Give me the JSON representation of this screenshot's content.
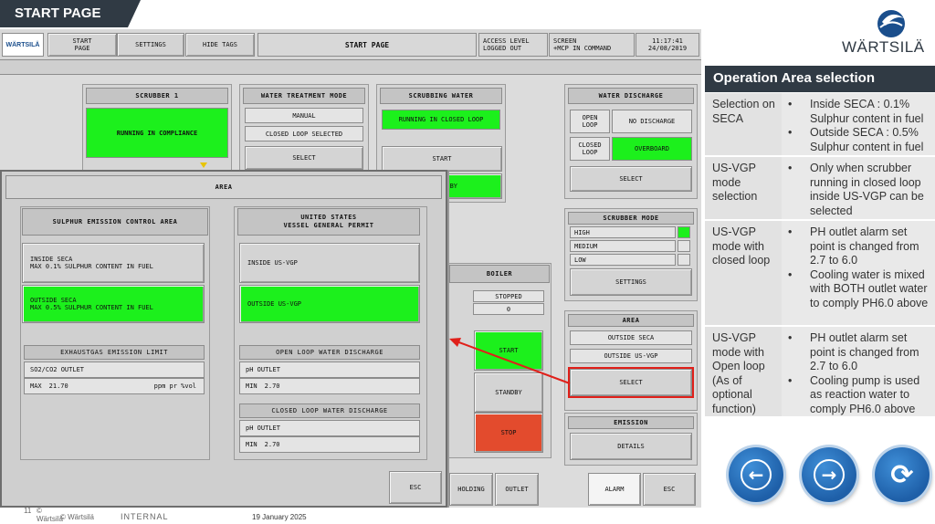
{
  "slide": {
    "title": "START PAGE"
  },
  "topbar": {
    "logo_text": "WÄRTSILÄ",
    "start_page_btn": "START\nPAGE",
    "settings_btn": "SETTINGS",
    "hide_tags_btn": "HIDE TAGS",
    "screen_title": "START PAGE",
    "access_level_label": "ACCESS LEVEL",
    "access_level_value": "LOGGED OUT",
    "screen_label": "SCREEN",
    "screen_value": "+MCP IN COMMAND",
    "time": "11:17:41",
    "date": "24/08/2019"
  },
  "scrubber": {
    "header": "SCRUBBER 1",
    "status": "RUNNING IN COMPLIANCE"
  },
  "water_treatment": {
    "header": "WATER TREATMENT MODE",
    "mode": "MANUAL",
    "loop": "CLOSED LOOP SELECTED",
    "select_btn": "SELECT"
  },
  "scrubbing_water": {
    "header": "SCRUBBING WATER",
    "status": "RUNNING IN CLOSED LOOP",
    "start_btn": "START",
    "standby_btn": "BY"
  },
  "water_discharge": {
    "header": "WATER DISCHARGE",
    "open_loop_label": "OPEN\nLOOP",
    "open_loop_value": "NO DISCHARGE",
    "closed_loop_label": "CLOSED\nLOOP",
    "closed_loop_value": "OVERBOARD",
    "select_btn": "SELECT"
  },
  "scrubber_mode": {
    "header": "SCRUBBER MODE",
    "high": "HIGH",
    "medium": "MEDIUM",
    "low": "LOW",
    "settings_btn": "SETTINGS"
  },
  "area_panel": {
    "header": "AREA",
    "outside_seca": "OUTSIDE SECA",
    "outside_usvgp": "OUTSIDE US-VGP",
    "select_btn": "SELECT"
  },
  "emission": {
    "header": "EMISSION",
    "details_btn": "DETAILS"
  },
  "boiler": {
    "header": "BOILER",
    "status": "STOPPED",
    "value": "0",
    "start_btn": "START",
    "standby_btn": "STANDBY",
    "stop_btn": "STOP"
  },
  "bottom_bar": {
    "holding_btn": "HOLDING",
    "outlet_btn": "OUTLET",
    "alarm_btn": "ALARM",
    "esc_btn": "ESC"
  },
  "area_dialog": {
    "title": "AREA",
    "seca_header": "SULPHUR EMISSION CONTROL AREA",
    "inside_seca": "INSIDE SECA\nMAX 0.1% SULPHUR CONTENT IN FUEL",
    "outside_seca": "OUTSIDE SECA\nMAX 0.5% SULPHUR CONTENT IN FUEL",
    "exhaust_header": "EXHAUSTGAS EMISSION LIMIT",
    "so2_label": "SO2/CO2 OUTLET",
    "so2_max_label": "MAX",
    "so2_max_value": "21.70",
    "so2_unit": "ppm pr %vol",
    "vgp_header": "UNITED STATES\nVESSEL GENERAL PERMIT",
    "inside_usvgp": "INSIDE US-VGP",
    "outside_usvgp": "OUTSIDE US-VGP",
    "open_loop_header": "OPEN LOOP WATER DISCHARGE",
    "open_ph_label": "pH OUTLET",
    "open_min_label": "MIN",
    "open_min_value": "2.70",
    "closed_loop_header": "CLOSED LOOP WATER DISCHARGE",
    "closed_ph_label": "pH OUTLET",
    "closed_min_label": "MIN",
    "closed_min_value": "2.70",
    "esc_btn": "ESC"
  },
  "sidebar": {
    "brand": "WÄRTSILÄ",
    "title": "Operation Area selection",
    "rows": [
      {
        "label": "Selection on SECA",
        "bullets": [
          "Inside SECA : 0.1% Sulphur content in fuel",
          "Outside SECA : 0.5% Sulphur content in fuel"
        ]
      },
      {
        "label": "US-VGP mode selection",
        "bullets": [
          "Only when scrubber running in closed loop inside US-VGP can be selected"
        ]
      },
      {
        "label": "US-VGP mode with closed loop",
        "bullets": [
          "PH outlet alarm set point is changed from 2.7 to 6.0",
          "Cooling water is mixed with BOTH outlet water to comply PH6.0 above"
        ]
      },
      {
        "label": "US-VGP mode with Open loop (As of optional function)",
        "bullets": [
          "PH outlet alarm set point is changed from 2.7 to 6.0",
          "Cooling pump is used as reaction water to comply PH6.0 above"
        ]
      }
    ]
  },
  "nav": {
    "back_icon": "arrow-left-icon",
    "forward_icon": "arrow-right-icon",
    "refresh_icon": "refresh-icon"
  },
  "footer": {
    "page_number": "11",
    "copyright": "©\nWärtsilä",
    "copyright2": "© Wärtsilä",
    "classification": "INTERNAL",
    "date": "19 January 2025"
  },
  "colors": {
    "status_green": "#1cf01c",
    "stop_red": "#e34b2d",
    "title_dark": "#303a44",
    "nav_blue": "#1e5fa8",
    "annotation_red": "#e0201a"
  }
}
